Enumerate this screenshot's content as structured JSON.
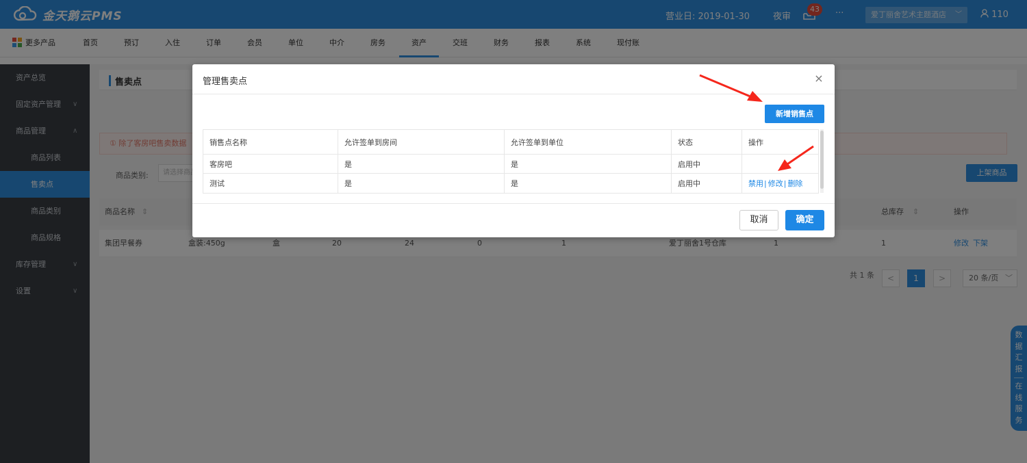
{
  "app": {
    "logo_text": "金天鹅云PMS",
    "business_date": "营业日: 2019-01-30",
    "night_audit": "夜审",
    "message_count": "43",
    "more": "···",
    "hotel_name": "爱丁丽舍艺术主题酒店",
    "user": "110",
    "brand_color": "#2f8fe0"
  },
  "nav": {
    "more_products": "更多产品",
    "items": [
      "首页",
      "预订",
      "入住",
      "订单",
      "会员",
      "单位",
      "中介",
      "房务",
      "资产",
      "交班",
      "财务",
      "报表",
      "系统",
      "现付账"
    ],
    "active": "资产"
  },
  "sidebar": {
    "items": [
      {
        "label": "资产总览"
      },
      {
        "label": "固定资产管理"
      },
      {
        "label": "商品管理"
      },
      {
        "label": "商品列表"
      },
      {
        "label": "售卖点"
      },
      {
        "label": "商品类别"
      },
      {
        "label": "商品规格"
      },
      {
        "label": "库存管理"
      },
      {
        "label": "设置"
      }
    ]
  },
  "page": {
    "title": "售卖点",
    "notice": "① 除了客房吧售卖数据",
    "filter_label": "商品类别:",
    "filter_placeholder": "请选择商品",
    "shelf_button": "上架商品",
    "table": {
      "headers": [
        "商品名称",
        "总库存",
        "操作"
      ],
      "row": [
        "集团早餐券",
        "盒装:450g",
        "盒",
        "20",
        "24",
        "0",
        "1",
        "爱丁丽舍1号仓库",
        "1",
        "1",
        "修改",
        "下架"
      ]
    },
    "pagination": {
      "total": "共 1 条",
      "prev": "<",
      "current": "1",
      "next": ">",
      "page_size": "20 条/页"
    }
  },
  "float_tab": {
    "report": [
      "数",
      "据",
      "汇",
      "报"
    ],
    "service": [
      "在",
      "线",
      "服",
      "务"
    ]
  },
  "modal": {
    "title": "管理售卖点",
    "close": "×",
    "add_button": "新增销售点",
    "headers": [
      "销售点名称",
      "允许签单到房间",
      "允许签单到单位",
      "状态",
      "操作"
    ],
    "rows": [
      {
        "name": "客房吧",
        "room": "是",
        "unit": "是",
        "status": "启用中",
        "actions": []
      },
      {
        "name": "测试",
        "room": "是",
        "unit": "是",
        "status": "启用中",
        "actions": [
          "禁用",
          "修改",
          "删除"
        ]
      }
    ],
    "cancel": "取消",
    "confirm": "确定"
  }
}
